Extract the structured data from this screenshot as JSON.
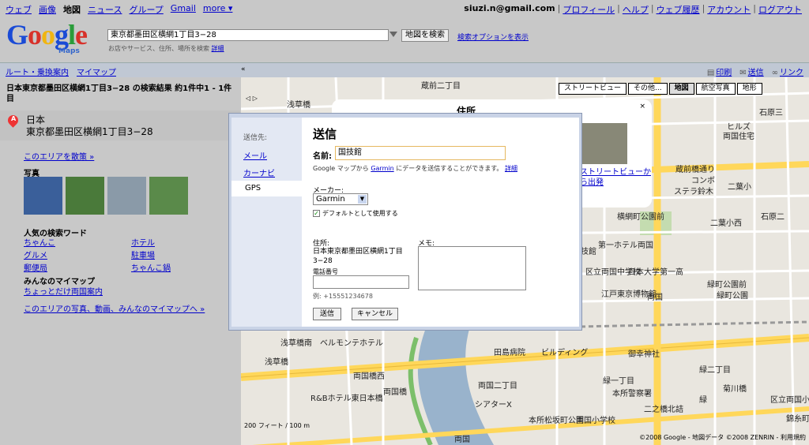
{
  "nav": [
    "ウェブ",
    "画像",
    "地図",
    "ニュース",
    "グループ",
    "Gmail",
    "more ▾"
  ],
  "nav_current_index": 2,
  "account": {
    "email": "siuzi.n@gmail.com",
    "links": [
      "プロフィール",
      "ヘルプ",
      "ウェブ履歴",
      "アカウント",
      "ログアウト"
    ]
  },
  "logo": {
    "text": "Google",
    "sub": "Maps",
    "colors": [
      "#1a4bd6",
      "#d8312a",
      "#f0b511",
      "#1a4bd6",
      "#2a9c3a",
      "#d8312a"
    ]
  },
  "search": {
    "value": "東京都墨田区横網1丁目3−28",
    "button": "地図を検索",
    "options": "検索オプションを表示",
    "hint": "お店やサービス、住所、場所を検索",
    "hint_link": "詳細"
  },
  "strip": {
    "left": [
      "ルート・乗換案内",
      "マイマップ"
    ],
    "collapse": "«",
    "print": "印刷",
    "send": "送信",
    "link": "リンク"
  },
  "result": {
    "summary": "日本東京都墨田区横網1丁目3−28 の検索結果 約1件中1 - 1件目",
    "marker": "A",
    "country": "日本",
    "address": "東京都墨田区横網1丁目3−28",
    "explore": "このエリアを散策 »",
    "photos_label": "写真",
    "photo_colors": [
      "#3a5f9a",
      "#4a7a3a",
      "#8a9aa8",
      "#5a8a4a"
    ],
    "keywords_label": "人気の検索ワード",
    "keywords": [
      "ちゃんこ",
      "ホテル",
      "グルメ",
      "駐車場",
      "郵便局",
      "ちゃんこ鍋"
    ],
    "mymaps_label": "みんなのマイマップ",
    "mymaps_link": "ちょっとだけ両国案内",
    "area_link": "このエリアの写真、動画、みんなのマイマップへ »"
  },
  "map": {
    "types": [
      "ストリートビュー",
      "その他...",
      "地図",
      "航空写真",
      "地形"
    ],
    "active_type_index": 2,
    "labels": [
      "蔵前二丁目",
      "浅草橋",
      "ヒルズ",
      "両国住宅",
      "石原三",
      "蔵前橋通り",
      "コンボ",
      "ステラ鈴木",
      "二葉小",
      "横網町公園前",
      "石原二",
      "二葉小西",
      "第一ホテル両国",
      "国技館",
      "日本大学第一高",
      "区立両国中学校",
      "江戸東京博物館",
      "両国",
      "緑町公園前",
      "緑町公園",
      "浅草橋南",
      "ベルモンテホテル",
      "浅草橋",
      "両国橋西",
      "田島病院",
      "ビルディング",
      "御幸神社",
      "緑一丁目",
      "緑二丁目",
      "両国橋",
      "両国二丁目",
      "本所警察署",
      "R&Bホテル東日本橋",
      "シアターX",
      "本所松坂町公園",
      "両国小学校",
      "緑",
      "菊川橋",
      "二之橋北詰",
      "両国",
      "区立両国小",
      "錦糸町"
    ],
    "pan": "◁ ▷",
    "scale": "200 フィート / 100 m",
    "copyright": "©2008 Google - 地図データ ©2008 ZENRIN - 利用規約"
  },
  "infowin": {
    "title": "住所",
    "close": "×",
    "sv_link": "ストリートビューから出発"
  },
  "dialog": {
    "sidebar_title": "送信先:",
    "options": [
      "メール",
      "カーナビ",
      "GPS"
    ],
    "title": "送信",
    "name_label": "名前:",
    "name_value": "国技館",
    "note": "Google マップから",
    "note_link": "Garmin",
    "note_tail": "にデータを送信することができます。",
    "note_detail": "詳細",
    "maker_label": "メーカー:",
    "maker_value": "Garmin",
    "default_label": "デフォルトとして使用する",
    "address_label": "住所:",
    "address": "日本東京都墨田区横網1丁目3−28",
    "phone_label": "電話番号",
    "phone_example": "例: +15551234678",
    "memo_label": "メモ:",
    "send": "送信",
    "cancel": "キャンセル"
  }
}
